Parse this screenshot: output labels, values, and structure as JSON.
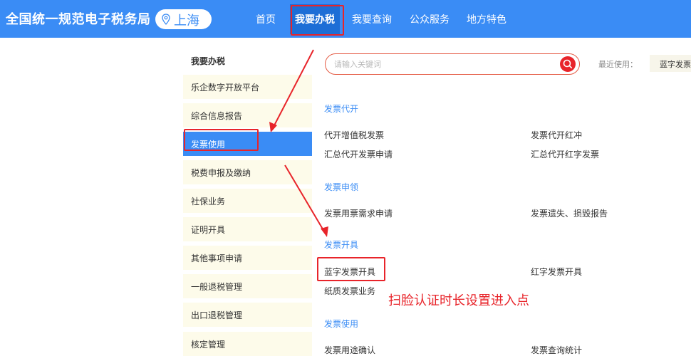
{
  "header": {
    "site_title": "全国统一规范电子税务局",
    "city": "上海",
    "nav": [
      {
        "label": "首页"
      },
      {
        "label": "我要办税",
        "active": true
      },
      {
        "label": "我要查询"
      },
      {
        "label": "公众服务"
      },
      {
        "label": "地方特色"
      }
    ]
  },
  "sidebar": {
    "heading": "我要办税",
    "items": [
      {
        "label": "乐企数字开放平台"
      },
      {
        "label": "综合信息报告"
      },
      {
        "label": "发票使用",
        "active": true
      },
      {
        "label": "税费申报及缴纳"
      },
      {
        "label": "社保业务"
      },
      {
        "label": "证明开具"
      },
      {
        "label": "其他事项申请"
      },
      {
        "label": "一般退税管理"
      },
      {
        "label": "出口退税管理"
      },
      {
        "label": "核定管理"
      }
    ]
  },
  "search": {
    "placeholder": "请输入关键词",
    "recent_label": "最近使用：",
    "recent_items": [
      "蓝字发票开具"
    ]
  },
  "sections": [
    {
      "title": "发票代开",
      "links": [
        "代开增值税发票",
        "发票代开红冲",
        "汇总代开发票申请",
        "汇总代开红字发票"
      ]
    },
    {
      "title": "发票申领",
      "links": [
        "发票用票需求申请",
        "发票遗失、损毁报告"
      ]
    },
    {
      "title": "发票开具",
      "links": [
        "蓝字发票开具",
        "红字发票开具",
        "纸质发票业务"
      ]
    },
    {
      "title": "发票使用",
      "links": [
        "发票用途确认",
        "发票查询统计"
      ]
    }
  ],
  "annotation": {
    "text": "扫脸认证时长设置进入点"
  },
  "colors": {
    "brand_blue": "#3a8cf5",
    "nav_active": "#1d6ed6",
    "annotation_red": "#e8242a",
    "menu_bg": "#fdfbea"
  }
}
